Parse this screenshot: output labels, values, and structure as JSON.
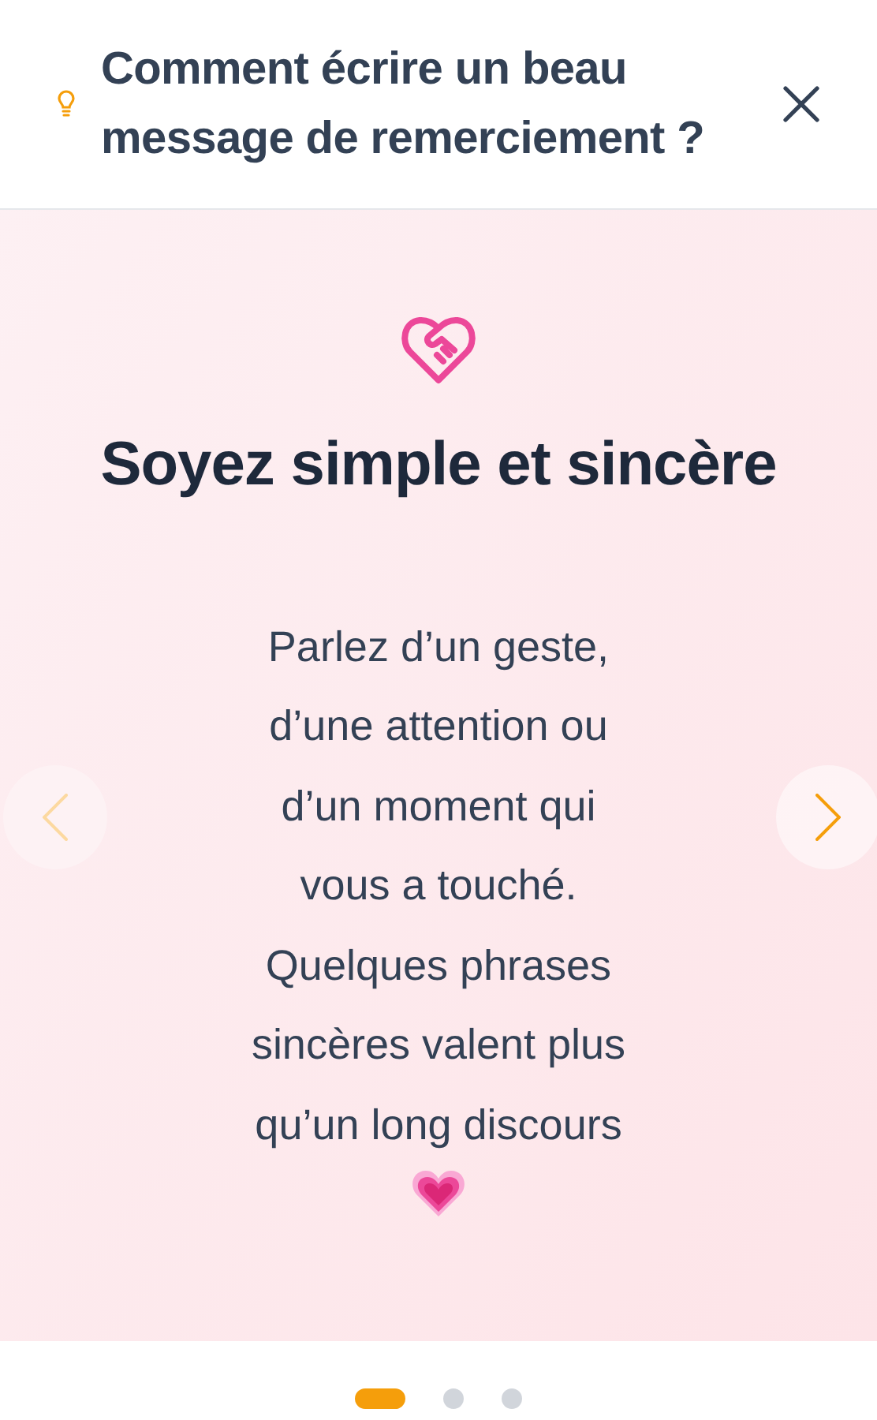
{
  "header": {
    "title": "Comment écrire un beau message de remerciement ?"
  },
  "slide": {
    "heading": "Soyez simple et sincère",
    "text": "Parlez d’un geste,\nd’une attention ou\nd’un moment qui\nvous a touché.\nQuelques phrases\nsincères valent plus\nqu’un long discours"
  },
  "nav": {
    "previous_disabled": true,
    "next_disabled": false
  },
  "dots": [
    {
      "selected": true
    },
    {
      "selected": false
    },
    {
      "selected": false
    }
  ]
}
